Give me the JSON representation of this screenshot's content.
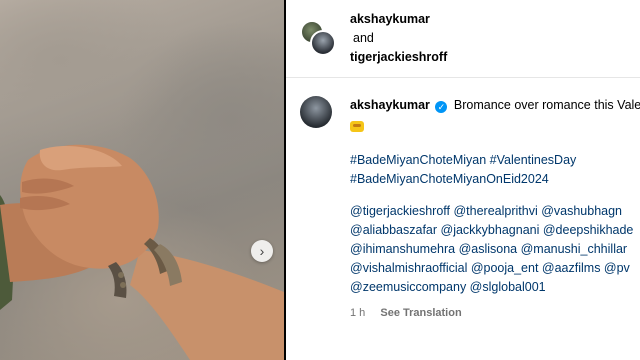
{
  "collab_header": {
    "user1": "akshaykumar",
    "connector": "and",
    "user2": "tigerjackieshroff"
  },
  "caption": {
    "username": "akshaykumar",
    "verified_icon": "verified-badge-icon",
    "text": "Bromance over romance this Vale",
    "emoji_icon": "tiger-face-emoji",
    "hashtags": [
      "#BadeMiyanChoteMiyan #ValentinesDay",
      "#BadeMiyanChoteMiyanOnEid2024"
    ],
    "mentions": [
      "@tigerjackieshroff @therealprithvi @vashubhagn",
      "@aliabbaszafar @jackkybhagnani @deepshikhade",
      "@ihimanshumehra @aslisona @manushi_chhillar",
      "@vishalmishraofficial @pooja_ent @aazfilms @pv",
      "@zeemusiccompany @slglobal001"
    ],
    "time": "1 h",
    "translate_label": "See Translation"
  },
  "media": {
    "next_icon": "chevron-right-icon",
    "next_glyph": "›"
  },
  "colors": {
    "link": "#00376b",
    "verified": "#0095f6",
    "muted": "#737373"
  }
}
